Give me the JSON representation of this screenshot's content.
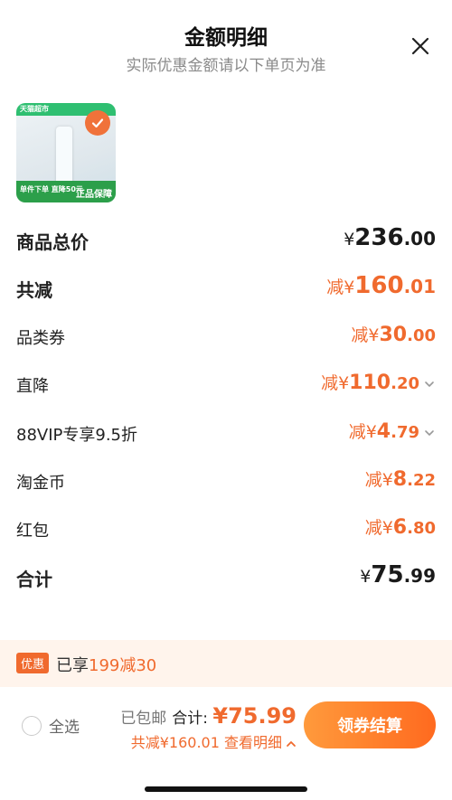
{
  "header": {
    "title": "金额明细",
    "subtitle": "实际优惠金额请以下单页为准",
    "close_icon": "close-icon"
  },
  "product": {
    "image_top_text": "天猫超市",
    "image_bottom_text": "单件下单 直降50元",
    "image_guarantee": "正品保障",
    "selected": true
  },
  "rows": [
    {
      "label": "商品总价",
      "prefix": "¥",
      "int": "236",
      "dec": ".00",
      "color": "#1a1a1a",
      "bold": true,
      "chevron": false
    },
    {
      "label": "共减",
      "prefix": "减¥",
      "int": "160",
      "dec": ".01",
      "color": "#f06a2e",
      "bold": true,
      "chevron": false
    },
    {
      "label": "品类券",
      "prefix": "减¥",
      "int": "30",
      "dec": ".00",
      "color": "#f06a2e",
      "bold": false,
      "chevron": false
    },
    {
      "label": "直降",
      "prefix": "减¥",
      "int": "110",
      "dec": ".20",
      "color": "#f06a2e",
      "bold": false,
      "chevron": true
    },
    {
      "label": "88VIP专享9.5折",
      "prefix": "减¥",
      "int": "4",
      "dec": ".79",
      "color": "#f06a2e",
      "bold": false,
      "chevron": true
    },
    {
      "label": "淘金币",
      "prefix": "减¥",
      "int": "8",
      "dec": ".22",
      "color": "#f06a2e",
      "bold": false,
      "chevron": false
    },
    {
      "label": "红包",
      "prefix": "减¥",
      "int": "6",
      "dec": ".80",
      "color": "#f06a2e",
      "bold": false,
      "chevron": false
    },
    {
      "label": "合计",
      "prefix": "¥",
      "int": "75",
      "dec": ".99",
      "color": "#1a1a1a",
      "bold": true,
      "chevron": false
    }
  ],
  "promo": {
    "badge": "优惠",
    "text_prefix": "已享",
    "text_highlight": "199减30"
  },
  "bottom": {
    "select_all": "全选",
    "shipping": "已包邮",
    "sum_label": "合计:",
    "sum_value": "¥75.99",
    "saved": "共减¥160.01",
    "detail_link": "查看明细",
    "checkout": "领券结算"
  },
  "colors": {
    "accent": "#f06a2e",
    "promo_bg": "#fff4ec"
  }
}
